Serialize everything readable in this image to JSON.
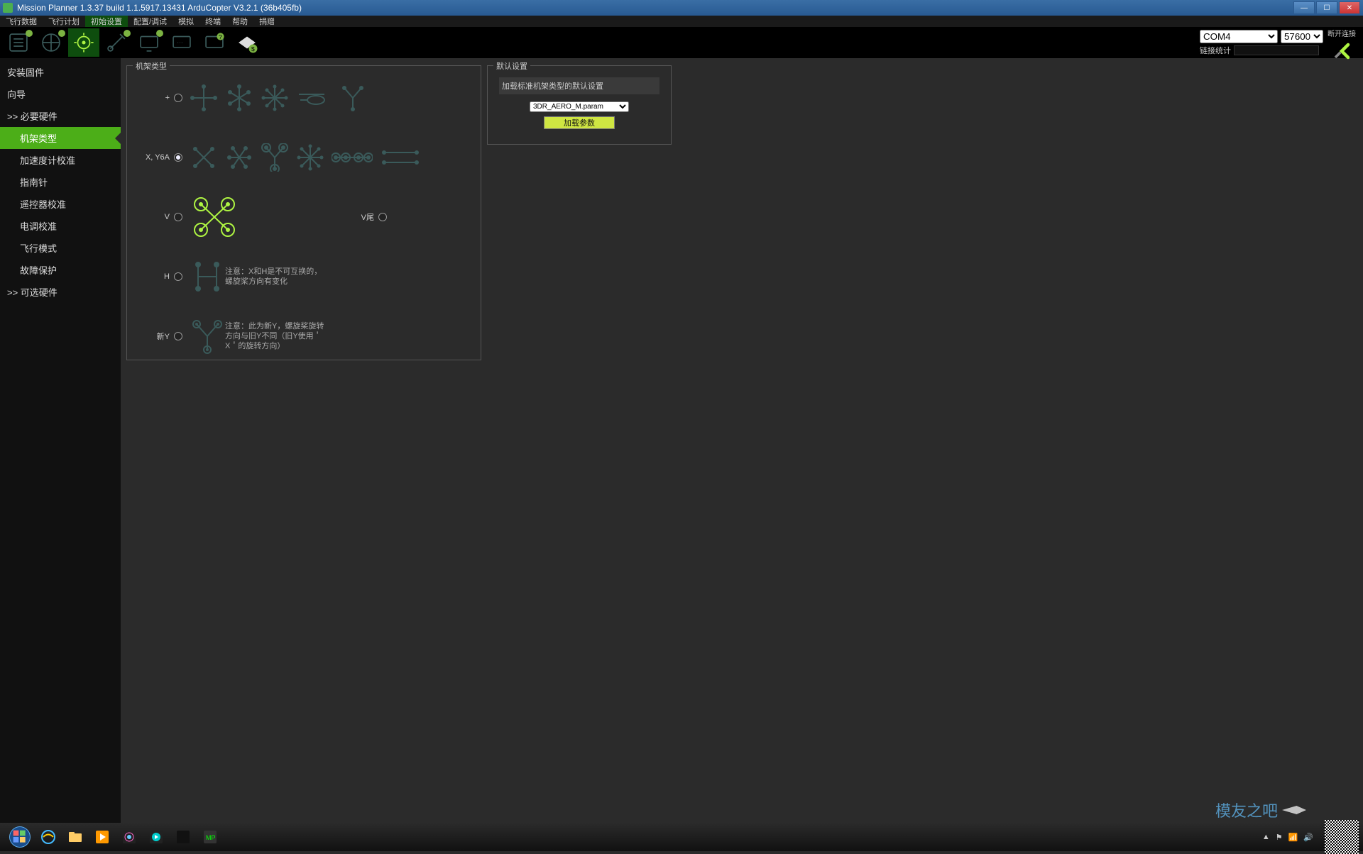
{
  "titlebar": {
    "title": "Mission Planner 1.3.37 build 1.1.5917.13431 ArduCopter V3.2.1 (36b405fb)"
  },
  "menubar": {
    "tabs": [
      "飞行数据",
      "飞行计划",
      "初始设置",
      "配置/调试",
      "模拟",
      "终端",
      "帮助",
      "捐赠"
    ],
    "active_index": 2,
    "com_port": "COM4",
    "baud": "57600",
    "disconnect_label": "断开连接",
    "stats_label": "链接统计"
  },
  "sidebar": {
    "items": [
      {
        "label": "安装固件",
        "indent": false,
        "prefix": ""
      },
      {
        "label": "向导",
        "indent": false,
        "prefix": ""
      },
      {
        "label": "必要硬件",
        "indent": false,
        "prefix": ">> "
      },
      {
        "label": "机架类型",
        "indent": true,
        "prefix": "",
        "active": true
      },
      {
        "label": "加速度计校准",
        "indent": true,
        "prefix": ""
      },
      {
        "label": "指南针",
        "indent": true,
        "prefix": ""
      },
      {
        "label": "遥控器校准",
        "indent": true,
        "prefix": ""
      },
      {
        "label": "电调校准",
        "indent": true,
        "prefix": ""
      },
      {
        "label": "飞行模式",
        "indent": true,
        "prefix": ""
      },
      {
        "label": "故障保护",
        "indent": true,
        "prefix": ""
      },
      {
        "label": "可选硬件",
        "indent": false,
        "prefix": ">> "
      }
    ]
  },
  "framebox": {
    "legend": "机架类型",
    "rows": [
      {
        "label": "+",
        "selected": false
      },
      {
        "label": "X, Y6A",
        "selected": true
      },
      {
        "label": "V",
        "selected": false,
        "extra_label": "V尾",
        "extra_selected": false
      },
      {
        "label": "H",
        "selected": false,
        "note": "注意：X和H是不可互换的，螺旋桨方向有变化"
      },
      {
        "label": "新Y",
        "selected": false,
        "note": "注意：此为新Y，螺旋桨旋转方向与旧Y不同（旧Y使用＇X＇的旋转方向）"
      }
    ]
  },
  "defaultbox": {
    "legend": "默认设置",
    "hint": "加载标准机架类型的默认设置",
    "select_value": "3DR_AERO_M.param",
    "button": "加载参数"
  },
  "tray": {
    "watermark": "模友之吧"
  }
}
